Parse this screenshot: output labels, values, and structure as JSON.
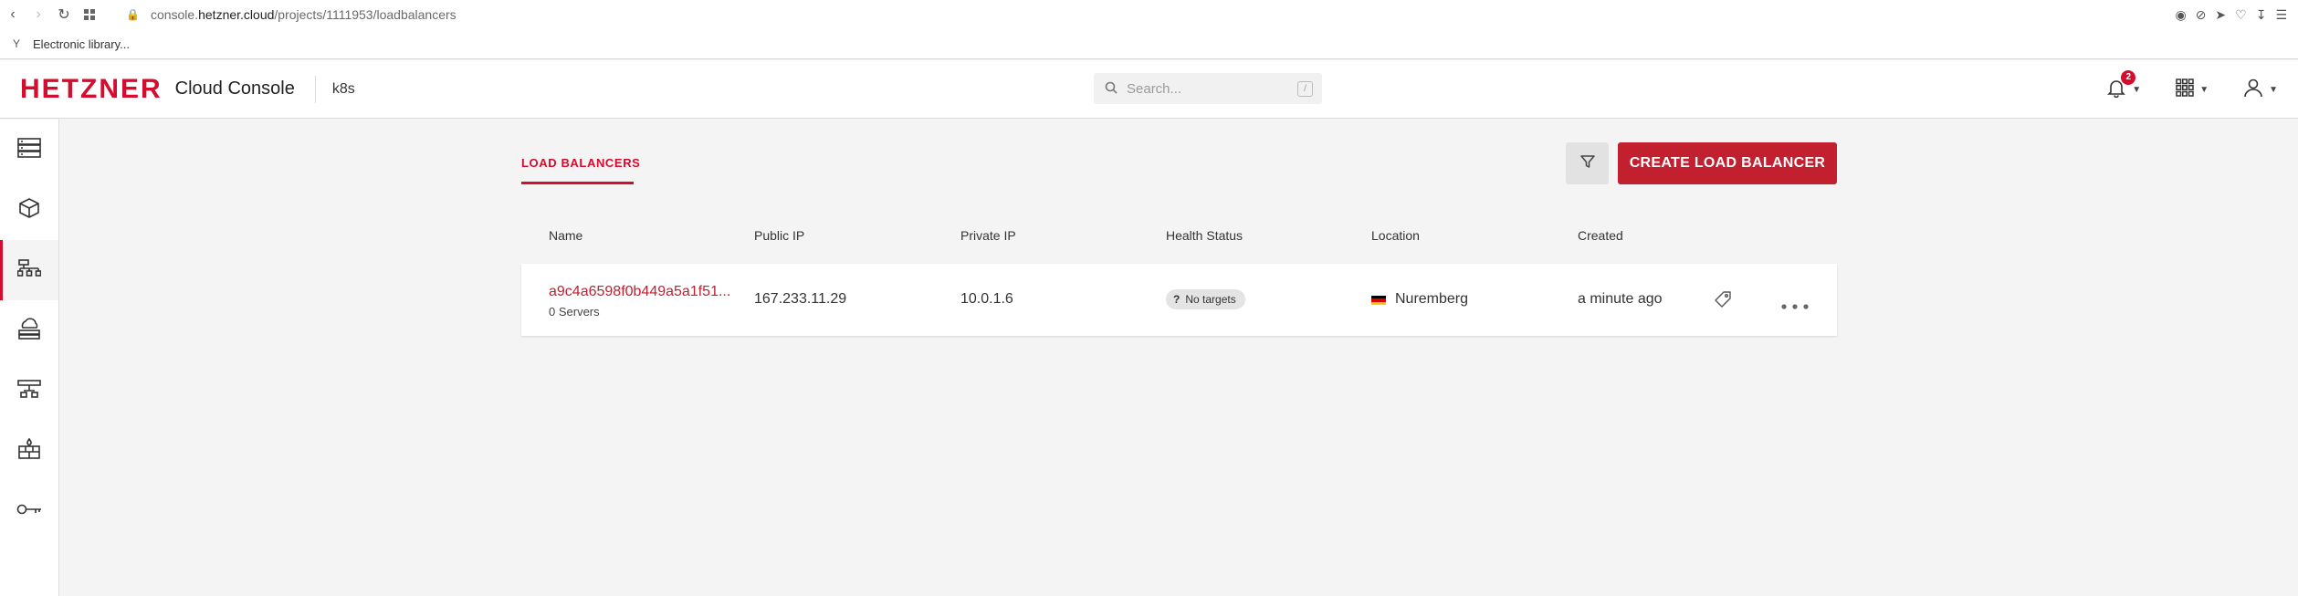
{
  "browser": {
    "url_prefix": "console.",
    "url_host": "hetzner.cloud",
    "url_path": "/projects/1111953/loadbalancers",
    "bookmark_label": "Electronic library..."
  },
  "header": {
    "logo_text": "HETZNER",
    "product_name": "Cloud Console",
    "project_name": "k8s",
    "search_placeholder": "Search...",
    "search_shortcut": "/",
    "notification_count": "2"
  },
  "sidebar": {
    "items": [
      {
        "name": "servers",
        "icon": "server-stack-icon"
      },
      {
        "name": "volumes",
        "icon": "cube-icon"
      },
      {
        "name": "load-balancers",
        "icon": "load-balancer-icon",
        "active": true
      },
      {
        "name": "floating-ips",
        "icon": "cloud-network-icon"
      },
      {
        "name": "networks",
        "icon": "network-icon"
      },
      {
        "name": "firewalls",
        "icon": "firewall-icon"
      },
      {
        "name": "security",
        "icon": "key-icon"
      }
    ]
  },
  "main": {
    "tab_label": "LOAD BALANCERS",
    "create_button_label": "CREATE LOAD BALANCER",
    "columns": [
      "Name",
      "Public IP",
      "Private IP",
      "Health Status",
      "Location",
      "Created"
    ],
    "rows": [
      {
        "name": "a9c4a6598f0b449a5a1f51...",
        "servers": "0 Servers",
        "public_ip": "167.233.11.29",
        "private_ip": "10.0.1.6",
        "health_status": "No targets",
        "health_icon": "?",
        "location": "Nuremberg",
        "created": "a minute ago"
      }
    ]
  },
  "colors": {
    "brand_red": "#d50c2d",
    "button_red": "#c21f2f",
    "background": "#f4f4f4"
  }
}
